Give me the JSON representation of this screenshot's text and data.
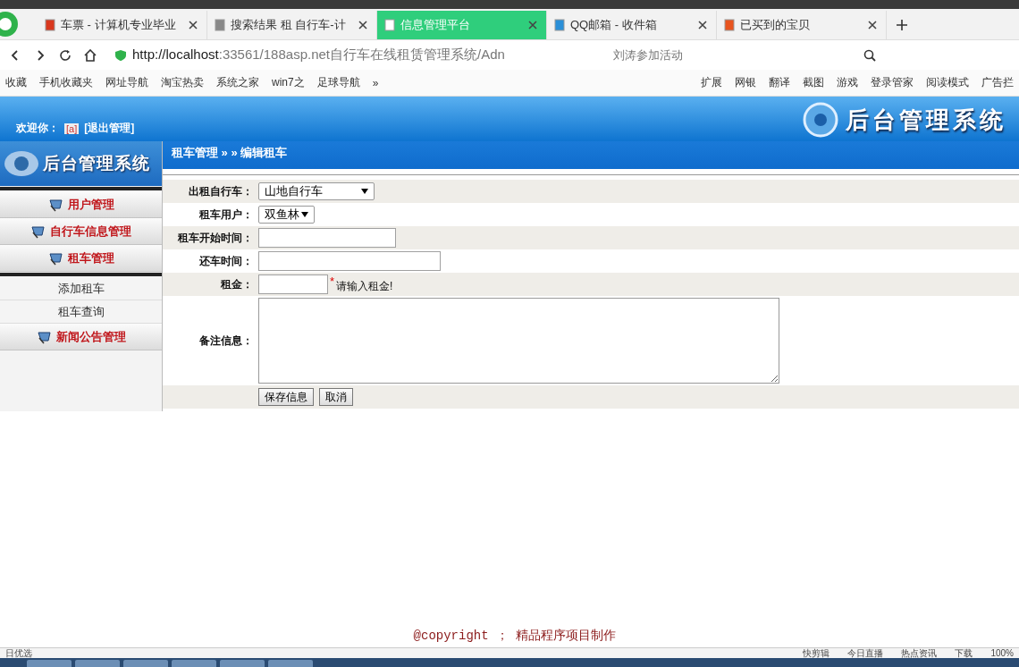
{
  "browser": {
    "tabs": [
      {
        "title": "车票 - 计算机专业毕业",
        "selected": false,
        "color": "#d9381e"
      },
      {
        "title": "搜索结果 租 自行车-计",
        "selected": false,
        "color": "#888888"
      },
      {
        "title": "信息管理平台",
        "selected": true,
        "color": "#ffffff"
      },
      {
        "title": "QQ邮箱 - 收件箱",
        "selected": false,
        "color": "#2a8fd8"
      },
      {
        "title": "已买到的宝贝",
        "selected": false,
        "color": "#e8541e"
      }
    ],
    "url_host": "http://localhost",
    "url_rest": ":33561/188asp.net自行车在线租赁管理系统/Adn",
    "search_hint": "刘涛参加活动",
    "bookmarks": [
      "收藏",
      "手机收藏夹",
      "网址导航",
      "淘宝热卖",
      "系统之家",
      "win7之",
      "足球导航",
      "»"
    ],
    "tools": [
      "扩展",
      "网银",
      "翻译",
      "截图",
      "游戏",
      "登录管家",
      "阅读模式",
      "广告拦"
    ]
  },
  "header": {
    "welcome": "欢迎你：",
    "user": "[a]",
    "logout": "[退出管理]",
    "title": "后台管理系统",
    "sidebar_title": "后台管理系统"
  },
  "breadcrumb": "租车管理 » » 编辑租车",
  "sidebar": {
    "items": [
      {
        "kind": "group",
        "label": "用户管理"
      },
      {
        "kind": "group",
        "label": "自行车信息管理"
      },
      {
        "kind": "group",
        "label": "租车管理",
        "children": [
          {
            "label": "添加租车"
          },
          {
            "label": "租车查询"
          }
        ]
      },
      {
        "kind": "group",
        "label": "新闻公告管理"
      }
    ]
  },
  "form": {
    "fields": [
      {
        "kind": "select",
        "label": "出租自行车：",
        "value": "山地自行车"
      },
      {
        "kind": "select",
        "label": "租车用户：",
        "value": "双鱼林"
      },
      {
        "kind": "text",
        "label": "租车开始时间："
      },
      {
        "kind": "text",
        "label": "还车时间："
      },
      {
        "kind": "text",
        "label": "租金：",
        "required": "*",
        "hint": "请输入租金!"
      },
      {
        "kind": "textarea",
        "label": "备注信息："
      }
    ],
    "buttons": [
      "保存信息",
      "取消"
    ]
  },
  "footer": "@copyright ； 精品程序项目制作",
  "status_bar": {
    "left": "日优选",
    "items": [
      "快剪辑",
      "今日直播",
      "热点资讯",
      "下载",
      "100%"
    ]
  }
}
